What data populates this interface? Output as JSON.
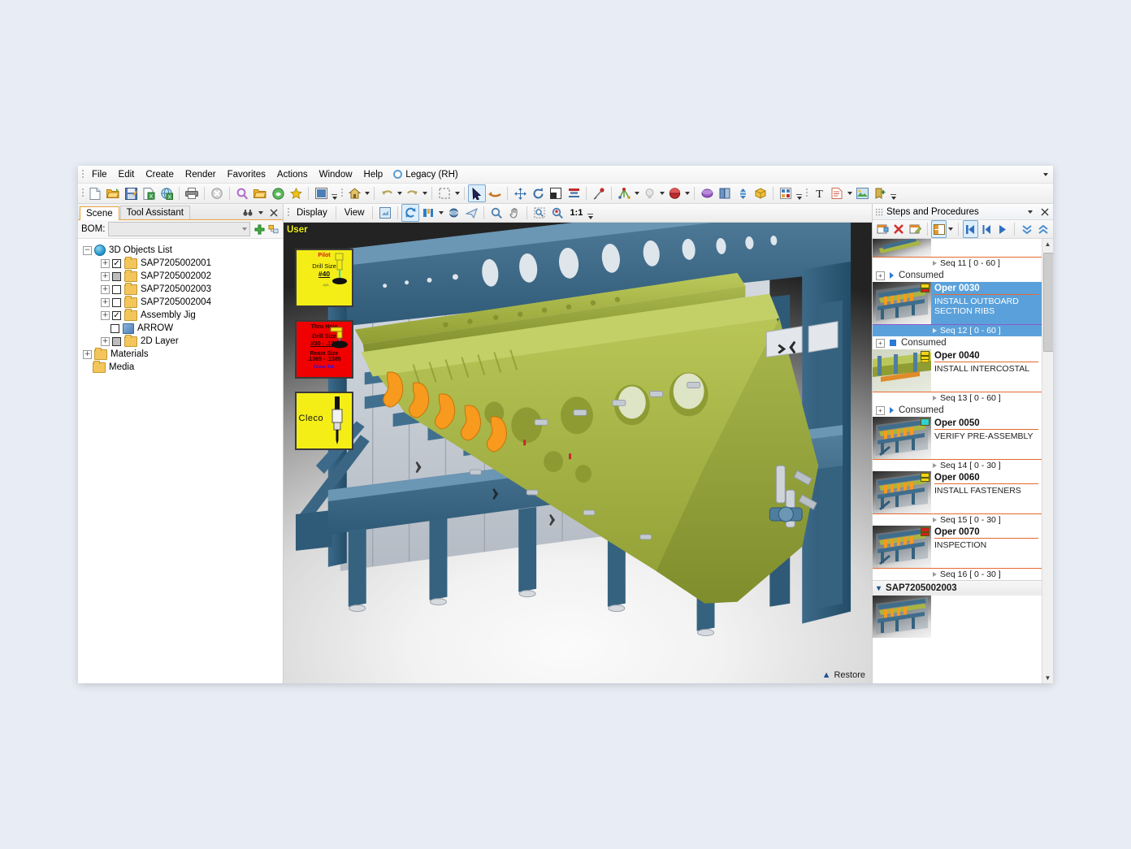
{
  "menubar": {
    "items": [
      "File",
      "Edit",
      "Create",
      "Render",
      "Favorites",
      "Actions",
      "Window",
      "Help"
    ],
    "mode_label": "Legacy (RH)",
    "mode_icon": "legacy-circle-icon"
  },
  "toolbar": {
    "groups": [
      {
        "name": "file-group",
        "buttons": [
          {
            "icon": "new-document-icon",
            "color": "#ffffff"
          },
          {
            "icon": "open-folder-icon",
            "color": "#f0b429"
          },
          {
            "icon": "save-icon",
            "color": "#5b7cb5"
          },
          {
            "icon": "export-icon",
            "color": "#3f9e4d"
          },
          {
            "icon": "publish-web-icon",
            "color": "#3f9e4d"
          }
        ]
      },
      {
        "name": "print-group",
        "buttons": [
          {
            "icon": "print-icon",
            "color": "#6f6f6f"
          }
        ]
      },
      {
        "name": "close-group",
        "buttons": [
          {
            "icon": "cancel-icon",
            "color": "#b9b9b9"
          }
        ]
      },
      {
        "name": "search-group",
        "buttons": [
          {
            "icon": "search-icon",
            "color": "#c07cd4"
          },
          {
            "icon": "open-recent-icon",
            "color": "#f0b429"
          },
          {
            "icon": "browser-icon",
            "color": "#4fa64f"
          },
          {
            "icon": "favorites-star-icon",
            "color": "#f2c218"
          }
        ]
      },
      {
        "name": "window-group",
        "buttons": [
          {
            "icon": "window-layout-icon",
            "color": "#4b7fb8"
          }
        ]
      },
      {
        "name": "home-group",
        "buttons": [
          {
            "icon": "home-icon",
            "color": "#d8b24a"
          }
        ]
      },
      {
        "name": "undo-group",
        "buttons": [
          {
            "icon": "undo-icon",
            "color": "#b9a55c"
          },
          {
            "icon": "redo-icon",
            "color": "#b9a55c"
          }
        ]
      },
      {
        "name": "select-group",
        "buttons": [
          {
            "icon": "marquee-select-icon",
            "color": "#8a8a8a"
          },
          {
            "icon": "arrow-select-icon",
            "color": "#1c1c4f"
          },
          {
            "icon": "rotate-view-icon",
            "color": "#c8741e"
          }
        ]
      },
      {
        "name": "transform-group",
        "buttons": [
          {
            "icon": "move-icon",
            "color": "#3a6fa8"
          },
          {
            "icon": "rotate-icon",
            "color": "#3a6fa8"
          },
          {
            "icon": "scale-icon",
            "color": "#2b2b2b"
          },
          {
            "icon": "align-icon",
            "color": "#c02b2b"
          }
        ]
      },
      {
        "name": "tools-group",
        "buttons": [
          {
            "icon": "pin-tool-icon",
            "color": "#c02b2b"
          },
          {
            "icon": "measure-icon",
            "color": "#5a9e3a"
          },
          {
            "icon": "light-icon",
            "color": "#b9b9b9"
          },
          {
            "icon": "material-ball-icon",
            "color": "#c02b2b"
          }
        ]
      },
      {
        "name": "object-group",
        "buttons": [
          {
            "icon": "shape-sphere-icon",
            "color": "#8a4fc0"
          },
          {
            "icon": "book-icon",
            "color": "#5b7cb5"
          },
          {
            "icon": "explode-icon",
            "color": "#3f7fbf"
          },
          {
            "icon": "cube-icon",
            "color": "#f0b429"
          },
          {
            "icon": "grid-matrix-icon",
            "color": "#3f7fbf"
          }
        ]
      },
      {
        "name": "text-group",
        "buttons": [
          {
            "icon": "text-tool-icon",
            "color": "#1c1c1c"
          },
          {
            "icon": "note-icon",
            "color": "#d4604a"
          },
          {
            "icon": "image-icon",
            "color": "#4fa64f"
          },
          {
            "icon": "add-marker-icon",
            "color": "#c8a11e"
          }
        ]
      }
    ]
  },
  "left_panel": {
    "tabs": [
      {
        "label": "Scene",
        "selected": true
      },
      {
        "label": "Tool Assistant",
        "selected": false
      }
    ],
    "tab_tools": [
      "binoculars-icon",
      "chevron-down-icon",
      "close-icon"
    ],
    "bom": {
      "label": "BOM:",
      "value": "",
      "placeholder": "",
      "add_icon": "add-plus-icon",
      "link_icon": "link-objects-icon"
    },
    "tree": [
      {
        "label": "3D Objects List",
        "level": 0,
        "icon": "globe-icon",
        "expander": "minus",
        "checkbox": "none"
      },
      {
        "label": "SAP7205002001",
        "level": 1,
        "icon": "folder-icon",
        "expander": "plus",
        "checkbox": "checked"
      },
      {
        "label": "SAP7205002002",
        "level": 1,
        "icon": "folder-icon",
        "expander": "plus",
        "checkbox": "gray"
      },
      {
        "label": "SAP7205002003",
        "level": 1,
        "icon": "folder-icon",
        "expander": "plus",
        "checkbox": "unchecked"
      },
      {
        "label": "SAP7205002004",
        "level": 1,
        "icon": "folder-icon",
        "expander": "plus",
        "checkbox": "unchecked"
      },
      {
        "label": "Assembly Jig",
        "level": 1,
        "icon": "folder-icon",
        "expander": "plus",
        "checkbox": "checked"
      },
      {
        "label": "ARROW",
        "level": 1,
        "icon": "cube-icon",
        "expander": "none",
        "checkbox": "unchecked"
      },
      {
        "label": "2D Layer",
        "level": 1,
        "icon": "folder-icon",
        "expander": "plus",
        "checkbox": "gray"
      },
      {
        "label": "Materials",
        "level": 0,
        "icon": "folder-icon",
        "expander": "plus",
        "checkbox": "none"
      },
      {
        "label": "Media",
        "level": 0,
        "icon": "folder-icon",
        "expander": "none",
        "checkbox": "none"
      }
    ]
  },
  "view_toolbar": {
    "display_label": "Display",
    "view_label": "View",
    "buttons": [
      {
        "icon": "render-preview-icon"
      },
      {
        "icon": "refresh-rotate-icon",
        "active": true
      },
      {
        "icon": "axis-align-icon"
      },
      {
        "icon": "perspective-icon"
      },
      {
        "icon": "fly-through-icon"
      },
      {
        "icon": "zoom-icon"
      },
      {
        "icon": "pan-hand-icon"
      },
      {
        "icon": "zoom-window-icon"
      },
      {
        "icon": "zoom-fit-icon"
      }
    ],
    "zoom_ratio": "1:1"
  },
  "viewport": {
    "view_label": "User",
    "restore_label": "Restore",
    "restore_icon": "chevron-up-icon",
    "annotations": [
      {
        "name": "pilot-drill-card",
        "style": "yellow",
        "title": "Pilot",
        "label": "Drill Size",
        "value": "#40",
        "footnote": "#(3)",
        "icon": "drill-icon"
      },
      {
        "name": "thru-hole-card",
        "style": "red",
        "title": "Thru Hole",
        "label": "Drill Size",
        "value": "#30 - .128",
        "label2": "Ream Size",
        "value2": ".1365 - .1385",
        "tolerance": "Close Tol.",
        "icon": "drill-icon"
      },
      {
        "name": "cleco-card",
        "style": "yellow",
        "title": "Cleco",
        "icon": "cleco-fastener-icon"
      }
    ],
    "model": {
      "jig_color": "#3f6d8c",
      "part_color": "#a8b544",
      "clip_color": "#f79a1e",
      "panel_color": "#c8cdd4"
    }
  },
  "right_panel": {
    "title": "Steps and Procedures",
    "title_icons": [
      "grip-dots-icon",
      "chevron-down-icon",
      "close-icon"
    ],
    "toolbar": [
      {
        "icon": "new-step-icon"
      },
      {
        "icon": "delete-step-icon"
      },
      {
        "icon": "edit-step-icon"
      },
      {
        "icon": "layout-view-icon",
        "active": true
      },
      {
        "icon": "dropdown-caret-icon"
      },
      {
        "icon": "first-step-icon",
        "active": true
      },
      {
        "icon": "previous-step-icon"
      },
      {
        "icon": "play-step-icon"
      },
      {
        "icon": "collapse-all-icon"
      },
      {
        "icon": "expand-all-icon"
      }
    ],
    "items": [
      {
        "type": "partial-thumb"
      },
      {
        "type": "seq",
        "label": "Seq 11 [ 0 - 60 ]",
        "accent": "#e46a2e"
      },
      {
        "type": "consumed",
        "label": "Consumed",
        "marker": "triangle"
      },
      {
        "type": "oper",
        "code": "Oper 0030",
        "desc": "INSTALL OUTBOARD SECTION RIBS",
        "selected": true,
        "badge": "yellow-red"
      },
      {
        "type": "seq",
        "label": "Seq 12 [ 0 - 60 ]",
        "accent": "#8a5ac8",
        "selected": true
      },
      {
        "type": "consumed",
        "label": "Consumed",
        "marker": "square"
      },
      {
        "type": "oper",
        "code": "Oper 0040",
        "desc": "INSTALL INTERCOSTAL",
        "selected": false,
        "badge": "yellow"
      },
      {
        "type": "seq",
        "label": "Seq 13 [ 0 - 60 ]",
        "accent": "#e46a2e"
      },
      {
        "type": "consumed",
        "label": "Consumed",
        "marker": "triangle"
      },
      {
        "type": "oper",
        "code": "Oper 0050",
        "desc": "VERIFY PRE-ASSEMBLY",
        "selected": false,
        "badge": "cyan"
      },
      {
        "type": "seq",
        "label": "Seq 14 [ 0 - 30 ]",
        "accent": "#e46a2e"
      },
      {
        "type": "oper",
        "code": "Oper 0060",
        "desc": "INSTALL FASTENERS",
        "selected": false,
        "badge": "yellow"
      },
      {
        "type": "seq",
        "label": "Seq 15 [ 0 - 30 ]",
        "accent": "#e46a2e"
      },
      {
        "type": "oper",
        "code": "Oper 0070",
        "desc": "INSPECTION",
        "selected": false,
        "badge": "red"
      },
      {
        "type": "seq",
        "label": "Seq 16 [ 0 - 30 ]",
        "accent": "#e46a2e"
      },
      {
        "type": "group",
        "label": "SAP7205002003",
        "icon": "chevron-down-icon"
      },
      {
        "type": "oper",
        "code": "",
        "desc": "",
        "selected": false,
        "badge": "none"
      }
    ]
  }
}
